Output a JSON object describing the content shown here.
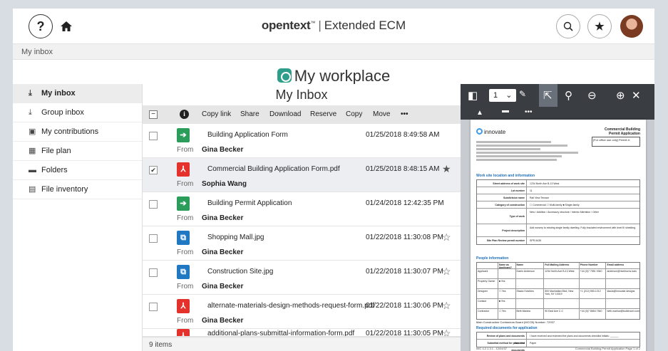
{
  "header": {
    "help_icon": "question-mark-icon",
    "home_icon": "home-icon",
    "brand": "opentext",
    "brand_tm": "™",
    "product": "Extended ECM",
    "search_icon": "search-icon",
    "favorites_icon": "star-icon"
  },
  "breadcrumb": "My inbox",
  "page_title": "My workplace",
  "sidebar": {
    "items": [
      {
        "label": "My inbox",
        "icon": "inbox-icon",
        "active": true
      },
      {
        "label": "Group inbox",
        "icon": "group-inbox-icon",
        "active": false
      },
      {
        "label": "My contributions",
        "icon": "contributions-icon",
        "active": false
      },
      {
        "label": "File plan",
        "icon": "file-plan-icon",
        "active": false
      },
      {
        "label": "Folders",
        "icon": "folder-icon",
        "active": false
      },
      {
        "label": "File inventory",
        "icon": "file-inventory-icon",
        "active": false
      }
    ]
  },
  "inbox": {
    "title": "My Inbox",
    "toolbar": {
      "copy_link": "Copy link",
      "share": "Share",
      "download": "Download",
      "reserve": "Reserve",
      "copy": "Copy",
      "move": "Move",
      "more": "•••"
    },
    "from_label": "From",
    "rows": [
      {
        "type": "workflow",
        "name": "Building Application Form",
        "from": "Gina Becker",
        "date": "01/25/2018 8:49:58 AM",
        "selected": false,
        "star": ""
      },
      {
        "type": "pdf",
        "name": "Commercial Building Application Form.pdf",
        "from": "Sophia Wang",
        "date": "01/25/2018 8:48:15 AM",
        "selected": true,
        "star": "★"
      },
      {
        "type": "workflow",
        "name": "Building Permit Application",
        "from": "Gina Becker",
        "date": "01/24/2018 12:42:35 PM",
        "selected": false,
        "star": ""
      },
      {
        "type": "image",
        "name": "Shopping Mall.jpg",
        "from": "Gina Becker",
        "date": "01/22/2018 11:30:08 PM",
        "selected": false,
        "star": "☆"
      },
      {
        "type": "image",
        "name": "Construction Site.jpg",
        "from": "Gina Becker",
        "date": "01/22/2018 11:30:07 PM",
        "selected": false,
        "star": "☆"
      },
      {
        "type": "pdf",
        "name": "alternate-materials-design-methods-request-form.pdf",
        "from": "Gina Becker",
        "date": "01/22/2018 11:30:06 PM",
        "selected": false,
        "star": "☆"
      },
      {
        "type": "pdf",
        "name": "additional-plans-submittal-information-form.pdf",
        "from": "",
        "date": "01/22/2018 11:30:05 PM",
        "selected": false,
        "star": "☆"
      }
    ],
    "count": "9 items"
  },
  "viewer": {
    "page_number": "1",
    "page_dropdown": "⌄",
    "doc": {
      "logo": "innovate",
      "title_line1": "Commercial Building",
      "title_line2": "Permit Application",
      "office_box": "[For office use only] Permit #:",
      "section_site": "Work site location and information",
      "rows": [
        {
          "k": "Street address of work site",
          "v": "1234 North Ave B-13 West"
        },
        {
          "k": "Lot number",
          "v": "11"
        },
        {
          "k": "Subdivision name",
          "v": "Rail View Terrace"
        },
        {
          "k": "Category of construction",
          "v": "☐ Commercial   ☐ Multi-family   ■ Single-family"
        },
        {
          "k": "Type of work",
          "v": "New / Addition / Accessory structure / Interior Alteration / Other"
        },
        {
          "k": "Project description",
          "v": "Add nursery to existing single family dwelling. Fully insulated environment with level III shielding."
        },
        {
          "k": "Site Plan Review permit number",
          "v": "SPR-5435"
        }
      ],
      "section_people": "People information",
      "people_headers": [
        "",
        "Same as Applicant?",
        "Name",
        "Full Mailing Address",
        "Phone Number",
        "Email address"
      ],
      "people": [
        [
          "Applicant",
          "",
          "Daren Anderson",
          "1234 North Ave B-13 West",
          "+44 (0)7 7551 9340",
          "anderson@riverburns.hars"
        ],
        [
          "Property Owner",
          "■ Yes",
          "",
          "",
          "",
          ""
        ],
        [
          "Designer",
          "☐ Yes",
          "Stacia Hutchins",
          "500 Manhattan Blvd, New York, NY 10019",
          "+1 (212) 550-1212",
          "stacia@innovate.designs"
        ],
        [
          "Contact",
          "■ Yes",
          "",
          "",
          "",
          ""
        ],
        [
          "Contractor",
          "☐ Yes",
          "Beth Marlow",
          "90 East Ave C-C",
          "+44 (0)7 8654 7540",
          "beth.marlow@buildroom.com"
        ]
      ],
      "mcob": "Main Construction Contractors Board (MCCB) Number:   72937",
      "section_docs": "Required documents for application",
      "docs": [
        {
          "k": "Review of plans and documents checklist",
          "v": "I have received and reviewed the plans and documents checklist   Initials: ______"
        },
        {
          "k": "Submittal method for plans and documents",
          "v": "Paper"
        }
      ],
      "footer_left": "IMC 4.2.1.3.1 - 12/04/37",
      "footer_right": "Commercial Building Permit Application Page 1 of 2"
    }
  },
  "colors": {
    "workflow": "#2a9d5a",
    "pdf": "#e4312b",
    "image": "#1f78c1",
    "accent": "#2e9e8a"
  }
}
